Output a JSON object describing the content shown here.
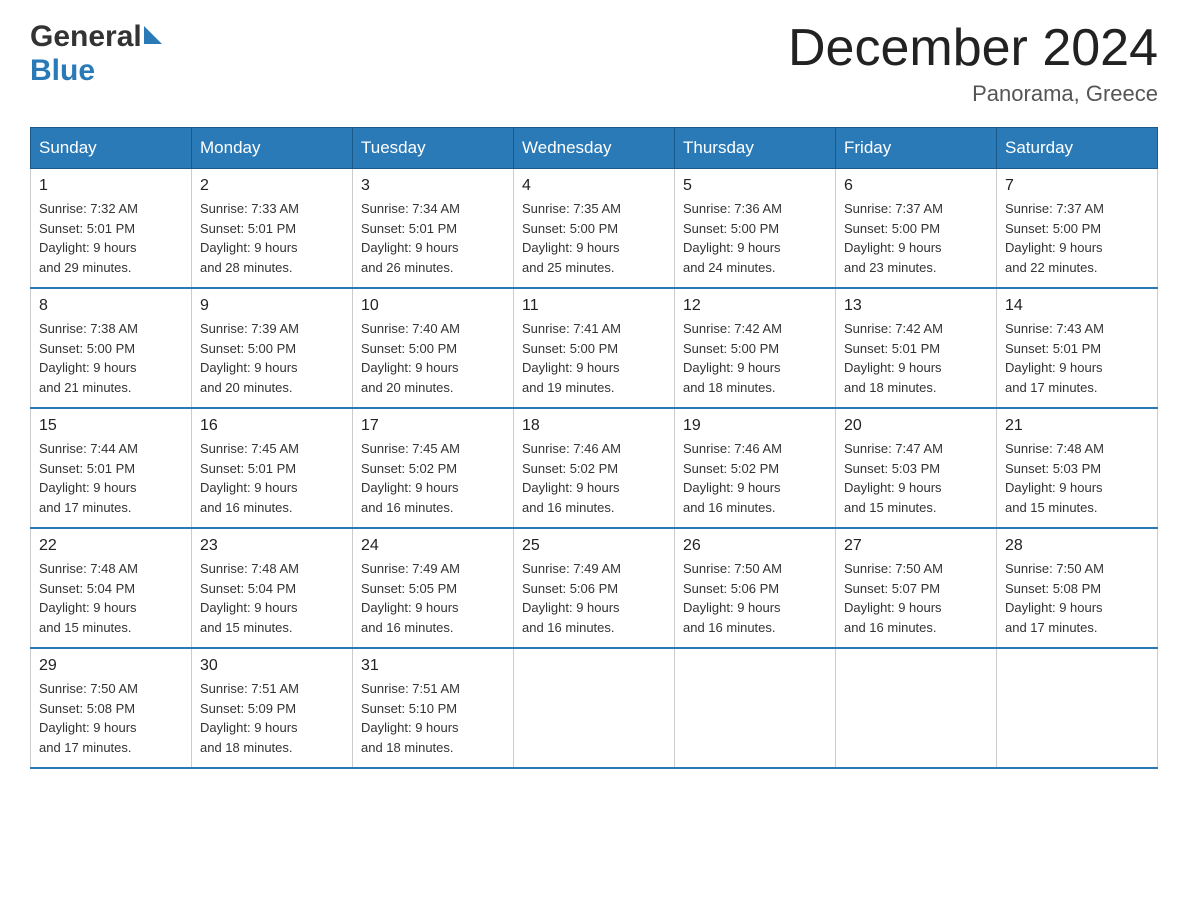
{
  "header": {
    "logo_general": "General",
    "logo_blue": "Blue",
    "title": "December 2024",
    "location": "Panorama, Greece"
  },
  "days_of_week": [
    "Sunday",
    "Monday",
    "Tuesday",
    "Wednesday",
    "Thursday",
    "Friday",
    "Saturday"
  ],
  "weeks": [
    [
      {
        "num": "1",
        "sunrise": "7:32 AM",
        "sunset": "5:01 PM",
        "daylight": "9 hours and 29 minutes."
      },
      {
        "num": "2",
        "sunrise": "7:33 AM",
        "sunset": "5:01 PM",
        "daylight": "9 hours and 28 minutes."
      },
      {
        "num": "3",
        "sunrise": "7:34 AM",
        "sunset": "5:01 PM",
        "daylight": "9 hours and 26 minutes."
      },
      {
        "num": "4",
        "sunrise": "7:35 AM",
        "sunset": "5:00 PM",
        "daylight": "9 hours and 25 minutes."
      },
      {
        "num": "5",
        "sunrise": "7:36 AM",
        "sunset": "5:00 PM",
        "daylight": "9 hours and 24 minutes."
      },
      {
        "num": "6",
        "sunrise": "7:37 AM",
        "sunset": "5:00 PM",
        "daylight": "9 hours and 23 minutes."
      },
      {
        "num": "7",
        "sunrise": "7:37 AM",
        "sunset": "5:00 PM",
        "daylight": "9 hours and 22 minutes."
      }
    ],
    [
      {
        "num": "8",
        "sunrise": "7:38 AM",
        "sunset": "5:00 PM",
        "daylight": "9 hours and 21 minutes."
      },
      {
        "num": "9",
        "sunrise": "7:39 AM",
        "sunset": "5:00 PM",
        "daylight": "9 hours and 20 minutes."
      },
      {
        "num": "10",
        "sunrise": "7:40 AM",
        "sunset": "5:00 PM",
        "daylight": "9 hours and 20 minutes."
      },
      {
        "num": "11",
        "sunrise": "7:41 AM",
        "sunset": "5:00 PM",
        "daylight": "9 hours and 19 minutes."
      },
      {
        "num": "12",
        "sunrise": "7:42 AM",
        "sunset": "5:00 PM",
        "daylight": "9 hours and 18 minutes."
      },
      {
        "num": "13",
        "sunrise": "7:42 AM",
        "sunset": "5:01 PM",
        "daylight": "9 hours and 18 minutes."
      },
      {
        "num": "14",
        "sunrise": "7:43 AM",
        "sunset": "5:01 PM",
        "daylight": "9 hours and 17 minutes."
      }
    ],
    [
      {
        "num": "15",
        "sunrise": "7:44 AM",
        "sunset": "5:01 PM",
        "daylight": "9 hours and 17 minutes."
      },
      {
        "num": "16",
        "sunrise": "7:45 AM",
        "sunset": "5:01 PM",
        "daylight": "9 hours and 16 minutes."
      },
      {
        "num": "17",
        "sunrise": "7:45 AM",
        "sunset": "5:02 PM",
        "daylight": "9 hours and 16 minutes."
      },
      {
        "num": "18",
        "sunrise": "7:46 AM",
        "sunset": "5:02 PM",
        "daylight": "9 hours and 16 minutes."
      },
      {
        "num": "19",
        "sunrise": "7:46 AM",
        "sunset": "5:02 PM",
        "daylight": "9 hours and 16 minutes."
      },
      {
        "num": "20",
        "sunrise": "7:47 AM",
        "sunset": "5:03 PM",
        "daylight": "9 hours and 15 minutes."
      },
      {
        "num": "21",
        "sunrise": "7:48 AM",
        "sunset": "5:03 PM",
        "daylight": "9 hours and 15 minutes."
      }
    ],
    [
      {
        "num": "22",
        "sunrise": "7:48 AM",
        "sunset": "5:04 PM",
        "daylight": "9 hours and 15 minutes."
      },
      {
        "num": "23",
        "sunrise": "7:48 AM",
        "sunset": "5:04 PM",
        "daylight": "9 hours and 15 minutes."
      },
      {
        "num": "24",
        "sunrise": "7:49 AM",
        "sunset": "5:05 PM",
        "daylight": "9 hours and 16 minutes."
      },
      {
        "num": "25",
        "sunrise": "7:49 AM",
        "sunset": "5:06 PM",
        "daylight": "9 hours and 16 minutes."
      },
      {
        "num": "26",
        "sunrise": "7:50 AM",
        "sunset": "5:06 PM",
        "daylight": "9 hours and 16 minutes."
      },
      {
        "num": "27",
        "sunrise": "7:50 AM",
        "sunset": "5:07 PM",
        "daylight": "9 hours and 16 minutes."
      },
      {
        "num": "28",
        "sunrise": "7:50 AM",
        "sunset": "5:08 PM",
        "daylight": "9 hours and 17 minutes."
      }
    ],
    [
      {
        "num": "29",
        "sunrise": "7:50 AM",
        "sunset": "5:08 PM",
        "daylight": "9 hours and 17 minutes."
      },
      {
        "num": "30",
        "sunrise": "7:51 AM",
        "sunset": "5:09 PM",
        "daylight": "9 hours and 18 minutes."
      },
      {
        "num": "31",
        "sunrise": "7:51 AM",
        "sunset": "5:10 PM",
        "daylight": "9 hours and 18 minutes."
      },
      null,
      null,
      null,
      null
    ]
  ],
  "labels": {
    "sunrise": "Sunrise:",
    "sunset": "Sunset:",
    "daylight": "Daylight:"
  }
}
